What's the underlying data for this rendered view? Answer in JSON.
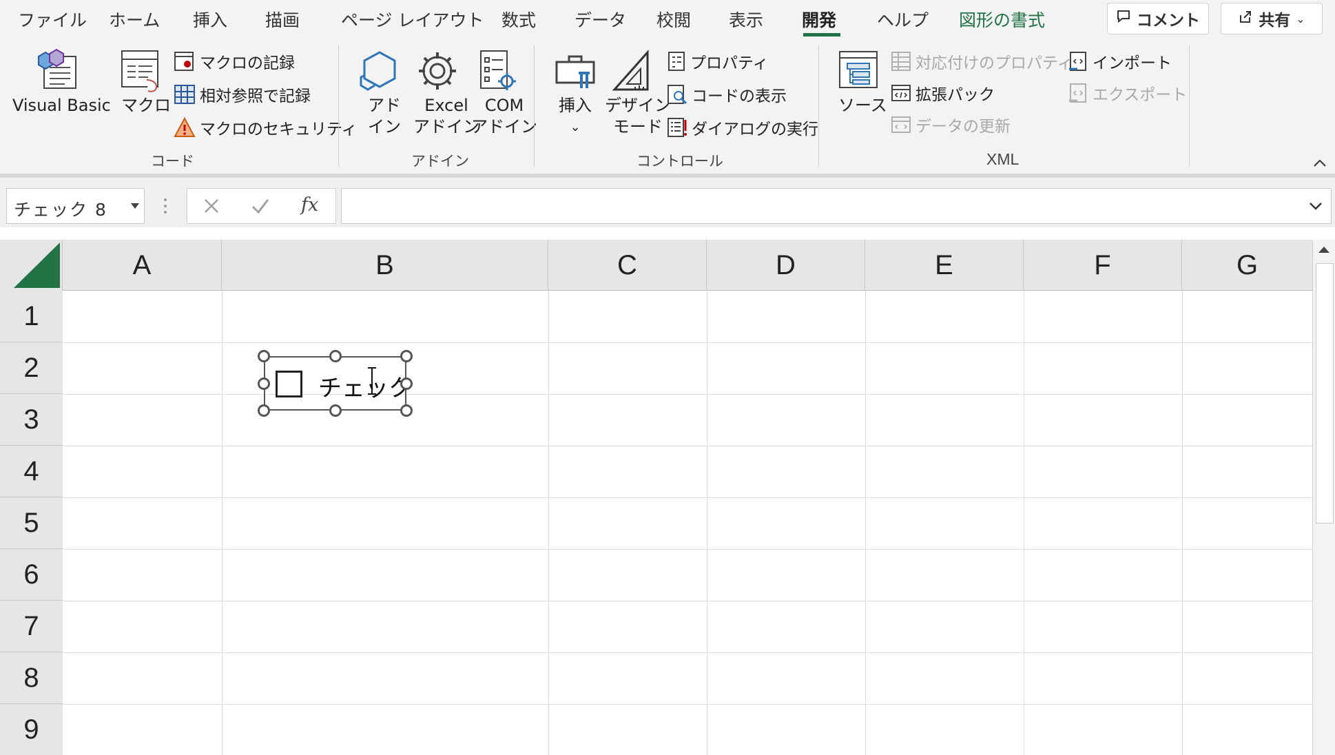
{
  "ribbon": {
    "tabs": [
      "ファイル",
      "ホーム",
      "挿入",
      "描画",
      "ページ レイアウト",
      "数式",
      "データ",
      "校閲",
      "表示",
      "開発",
      "ヘルプ",
      "図形の書式"
    ],
    "active_tab": "開発",
    "comment_label": "コメント",
    "share_label": "共有",
    "code": {
      "group_label": "コード",
      "visual_basic": "Visual Basic",
      "macro": "マクロ",
      "record_macro": "マクロの記録",
      "relative_ref": "相対参照で記録",
      "macro_security": "マクロのセキュリティ"
    },
    "addins": {
      "group_label": "アドイン",
      "addin_l1": "アド",
      "addin_l2": "イン",
      "excel_l1": "Excel",
      "excel_l2": "アドイン",
      "com_l1": "COM",
      "com_l2": "アドイン"
    },
    "controls": {
      "group_label": "コントロール",
      "insert": "挿入",
      "design_l1": "デザイン",
      "design_l2": "モード",
      "properties": "プロパティ",
      "view_code": "コードの表示",
      "run_dialog": "ダイアログの実行"
    },
    "xml": {
      "group_label": "XML",
      "source": "ソース",
      "map_properties": "対応付けのプロパティ",
      "expansion_packs": "拡張パック",
      "refresh_data": "データの更新",
      "import": "インポート",
      "export": "エクスポート"
    },
    "colors": {
      "accent": "#217346",
      "disabled": "#a8a8a8"
    }
  },
  "formula_bar": {
    "name_box": "チェック 8",
    "fx": "fx",
    "value": ""
  },
  "sheet": {
    "columns": [
      "A",
      "B",
      "C",
      "D",
      "E",
      "F",
      "G"
    ],
    "rows": [
      "1",
      "2",
      "3",
      "4",
      "5",
      "6",
      "7",
      "8",
      "9"
    ],
    "checkbox_label": "チェック"
  }
}
